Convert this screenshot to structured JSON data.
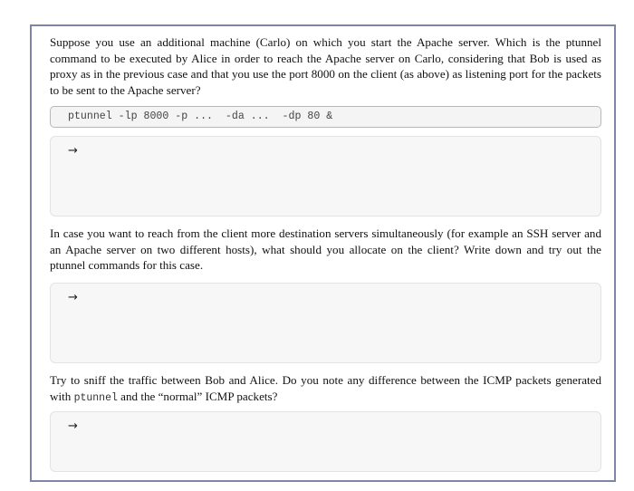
{
  "exercise": {
    "question_1": "Suppose you use an additional machine (Carlo) on which you start the Apache server. Which is the ptunnel command to be executed by Alice in order to reach the Apache server on Carlo, considering that Bob is used as proxy as in the previous case and that you use the port 8000 on the client (as above) as listening port for the packets to be sent to the Apache server?",
    "command": "ptunnel -lp 8000 -p ...  -da ...  -dp 80 &",
    "question_2": "In case you want to reach from the client more destination servers simultaneously (for example an SSH server and an Apache server on two different hosts), what should you allocate on the client? Write down and try out the ptunnel commands for this case.",
    "question_3_before": "Try to sniff the traffic between Bob and Alice. Do you note any difference between the ICMP packets generated with ",
    "question_3_code": "ptunnel",
    "question_3_after": " and the “normal” ICMP packets?",
    "answer_arrow": "→"
  }
}
